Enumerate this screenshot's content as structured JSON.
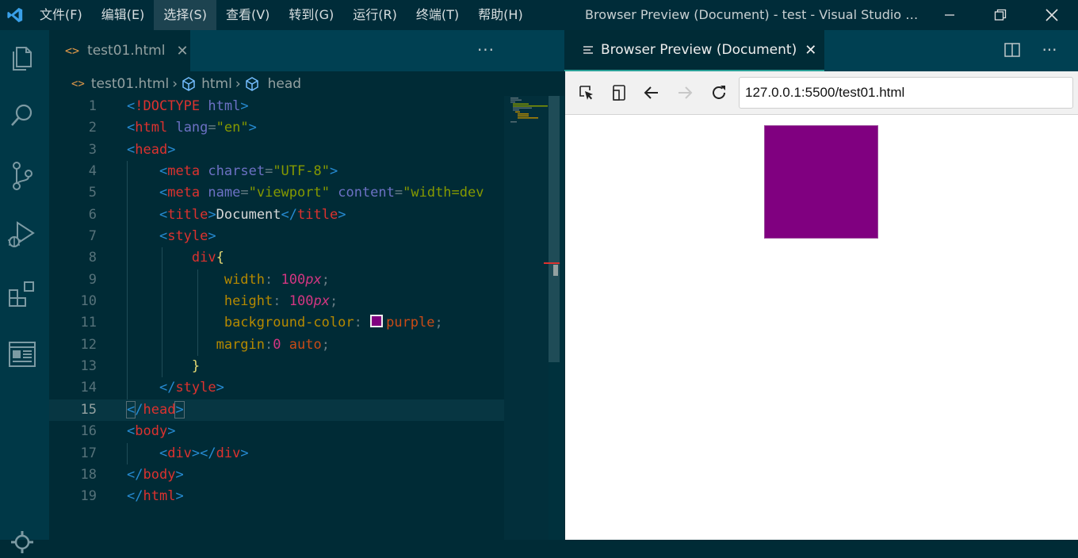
{
  "titlebar": {
    "menu": [
      {
        "label": "文件(F)"
      },
      {
        "label": "编辑(E)"
      },
      {
        "label": "选择(S)"
      },
      {
        "label": "查看(V)"
      },
      {
        "label": "转到(G)"
      },
      {
        "label": "运行(R)"
      },
      {
        "label": "终端(T)"
      },
      {
        "label": "帮助(H)"
      }
    ],
    "window_title": "Browser Preview (Document) - test - Visual Studio C..."
  },
  "colors": {
    "accent": "#2aa198",
    "editor_bg": "#002b36",
    "preview_div": "#800080"
  },
  "editor": {
    "tab": {
      "label": "test01.html"
    },
    "breadcrumb": {
      "file": "test01.html",
      "html": "html",
      "head": "head"
    },
    "current_line": 15,
    "lines": [
      {
        "n": "1"
      },
      {
        "n": "2"
      },
      {
        "n": "3"
      },
      {
        "n": "4"
      },
      {
        "n": "5"
      },
      {
        "n": "6"
      },
      {
        "n": "7"
      },
      {
        "n": "8"
      },
      {
        "n": "9"
      },
      {
        "n": "10"
      },
      {
        "n": "11"
      },
      {
        "n": "12"
      },
      {
        "n": "13"
      },
      {
        "n": "14"
      },
      {
        "n": "15"
      },
      {
        "n": "16"
      },
      {
        "n": "17"
      },
      {
        "n": "18"
      },
      {
        "n": "19"
      }
    ]
  },
  "preview": {
    "tab": {
      "label": "Browser Preview (Document)"
    },
    "url": "127.0.0.1:5500/test01.html"
  }
}
